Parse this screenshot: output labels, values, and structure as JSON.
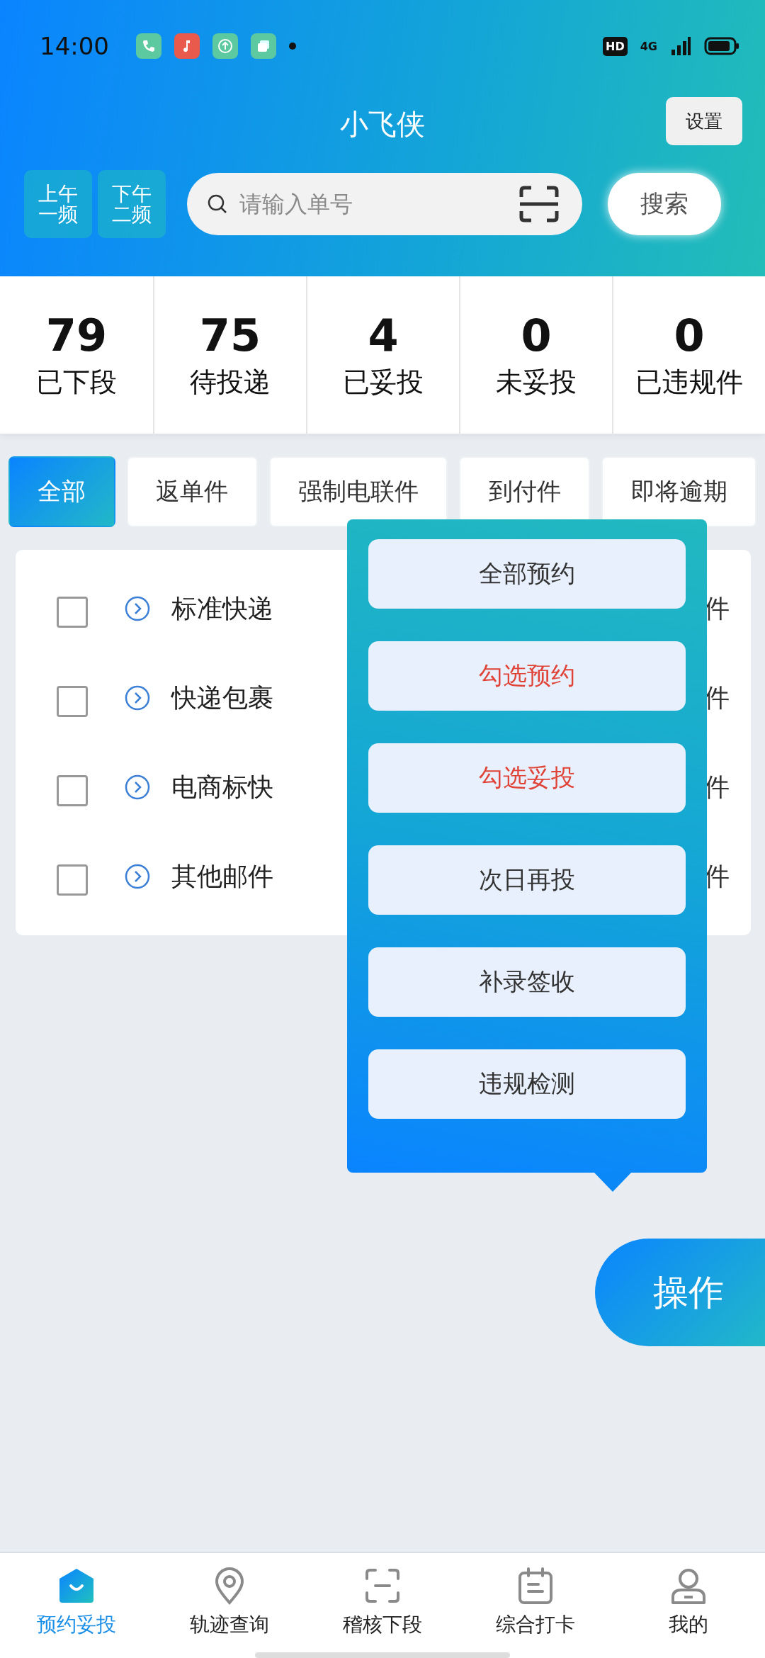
{
  "status_bar": {
    "time": "14:00",
    "hd": "HD",
    "network": "4G"
  },
  "header": {
    "title": "小飞侠",
    "settings_button": "设置"
  },
  "shift_buttons": [
    {
      "label": "上午一频"
    },
    {
      "label": "下午二频"
    }
  ],
  "search": {
    "placeholder": "请输入单号",
    "button": "搜索"
  },
  "stats": [
    {
      "value": "79",
      "label": "已下段"
    },
    {
      "value": "75",
      "label": "待投递"
    },
    {
      "value": "4",
      "label": "已妥投"
    },
    {
      "value": "0",
      "label": "未妥投"
    },
    {
      "value": "0",
      "label": "已违规件"
    }
  ],
  "filters": [
    {
      "label": "全部",
      "selected": true
    },
    {
      "label": "返单件",
      "selected": false
    },
    {
      "label": "强制电联件",
      "selected": false
    },
    {
      "label": "到付件",
      "selected": false
    },
    {
      "label": "即将逾期",
      "selected": false
    }
  ],
  "rows": [
    {
      "name": "标准快递",
      "checked": false,
      "column_3": "件"
    },
    {
      "name": "快递包裹",
      "checked": false,
      "column_3": "件"
    },
    {
      "name": "电商标快",
      "checked": false,
      "column_3": "件"
    },
    {
      "name": "其他邮件",
      "checked": false,
      "column_3": "件"
    }
  ],
  "popup_menu": [
    {
      "label": "全部预约",
      "kind": "normal"
    },
    {
      "label": "勾选预约",
      "kind": "warning"
    },
    {
      "label": "勾选妥投",
      "kind": "warning"
    },
    {
      "label": "次日再投",
      "kind": "normal"
    },
    {
      "label": "补录签收",
      "kind": "normal"
    },
    {
      "label": "违规检测",
      "kind": "normal"
    }
  ],
  "action_button": "操作",
  "bottom_nav": [
    {
      "label": "预约妥投",
      "selected": true
    },
    {
      "label": "轨迹查询",
      "selected": false
    },
    {
      "label": "稽核下段",
      "selected": false
    },
    {
      "label": "综合打卡",
      "selected": false
    },
    {
      "label": "我的",
      "selected": false
    }
  ]
}
